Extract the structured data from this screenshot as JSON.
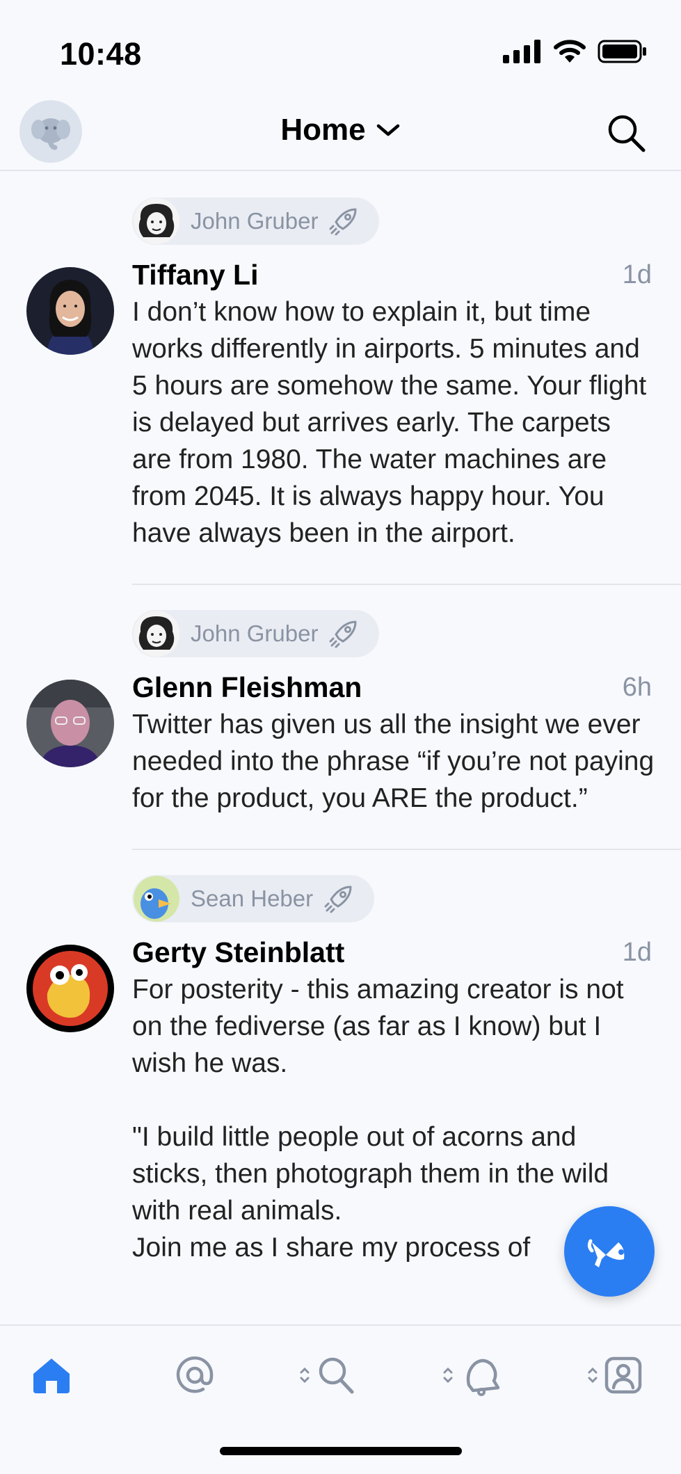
{
  "status_bar": {
    "time": "10:48"
  },
  "nav": {
    "title": "Home"
  },
  "posts": [
    {
      "boosted_by": "John Gruber",
      "author": "Tiffany Li",
      "time": "1d",
      "content": "I don’t know how to explain it, but time works differently in airports. 5 minutes and 5 hours are somehow the same. Your flight is delayed but arrives early. The carpets are from 1980. The water machines are from 2045. It is always happy hour. You have always been in the airport."
    },
    {
      "boosted_by": "John Gruber",
      "author": "Glenn Fleishman",
      "time": "6h",
      "content": "Twitter has given us all the insight we ever needed into the phrase “if you’re not paying for the product, you ARE the product.”"
    },
    {
      "boosted_by": "Sean Heber",
      "author": "Gerty Steinblatt",
      "time": "1d",
      "content": "For posterity - this amazing creator is not on the fediverse (as far as I know) but I wish he was.\n\n\"I build little people out of acorns and sticks, then photograph them in the wild with real animals.\nJoin me as I share my process of"
    }
  ],
  "colors": {
    "accent": "#2b7ef2",
    "secondary_text": "#8a93a3",
    "divider": "#e2e5ea"
  },
  "tabs": [
    "home-icon",
    "mentions-icon",
    "explore-icon",
    "notifications-icon",
    "profile-icon"
  ]
}
